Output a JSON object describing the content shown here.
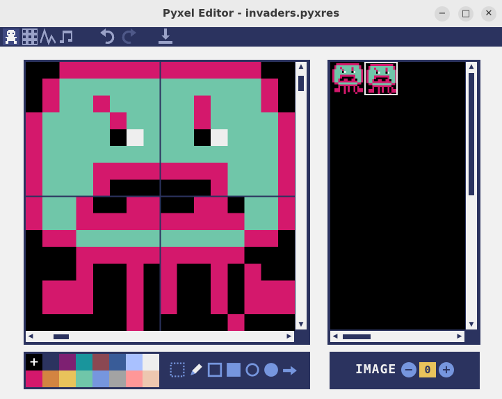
{
  "window": {
    "title": "Pyxel Editor - invaders.pyxres",
    "minimize": "−",
    "maximize": "□",
    "close": "✕"
  },
  "toolbar": {
    "editors": [
      {
        "name": "image-editor-icon",
        "selected": true
      },
      {
        "name": "tilemap-editor-icon",
        "selected": false
      },
      {
        "name": "sound-editor-icon",
        "selected": false
      },
      {
        "name": "music-editor-icon",
        "selected": false
      }
    ],
    "undo_icon": "undo-icon",
    "redo_icon": "redo-icon",
    "save_icon": "save-icon"
  },
  "palette": {
    "colors": [
      "#000000",
      "#2b335f",
      "#7e2072",
      "#19959c",
      "#8b4852",
      "#395c98",
      "#a9c1ff",
      "#eeeeee",
      "#d4186c",
      "#d38441",
      "#e9c35b",
      "#70c6a9",
      "#7696de",
      "#a3a3a3",
      "#ff9798",
      "#edc7b0"
    ],
    "selected_index": 0,
    "selected_glyph": "+"
  },
  "tools": [
    "select-tool-icon",
    "pencil-tool-icon",
    "rect-outline-tool-icon",
    "rect-fill-tool-icon",
    "circle-outline-tool-icon",
    "circle-fill-tool-icon",
    "bucket-fill-tool-icon"
  ],
  "image_bank": {
    "label": "IMAGE",
    "index": "0",
    "minus": "−",
    "plus": "+"
  },
  "sprite": {
    "palette": {
      "0": "#000000",
      "1": "#d4186c",
      "2": "#70c6a9",
      "3": "#eeeeee"
    },
    "rows": [
      "0011111111111100",
      "0122222222222210",
      "0122122222122210",
      "1222212222122221",
      "1222203222032221",
      "1222222222222221",
      "1222111111112221",
      "1222100000012221",
      "1221001100110221",
      "1221111111111221",
      "0112222222222110",
      "0001111111111000",
      "0001001010010100",
      "0111001010010111",
      "0111001010010111",
      "0000001000001000"
    ]
  }
}
